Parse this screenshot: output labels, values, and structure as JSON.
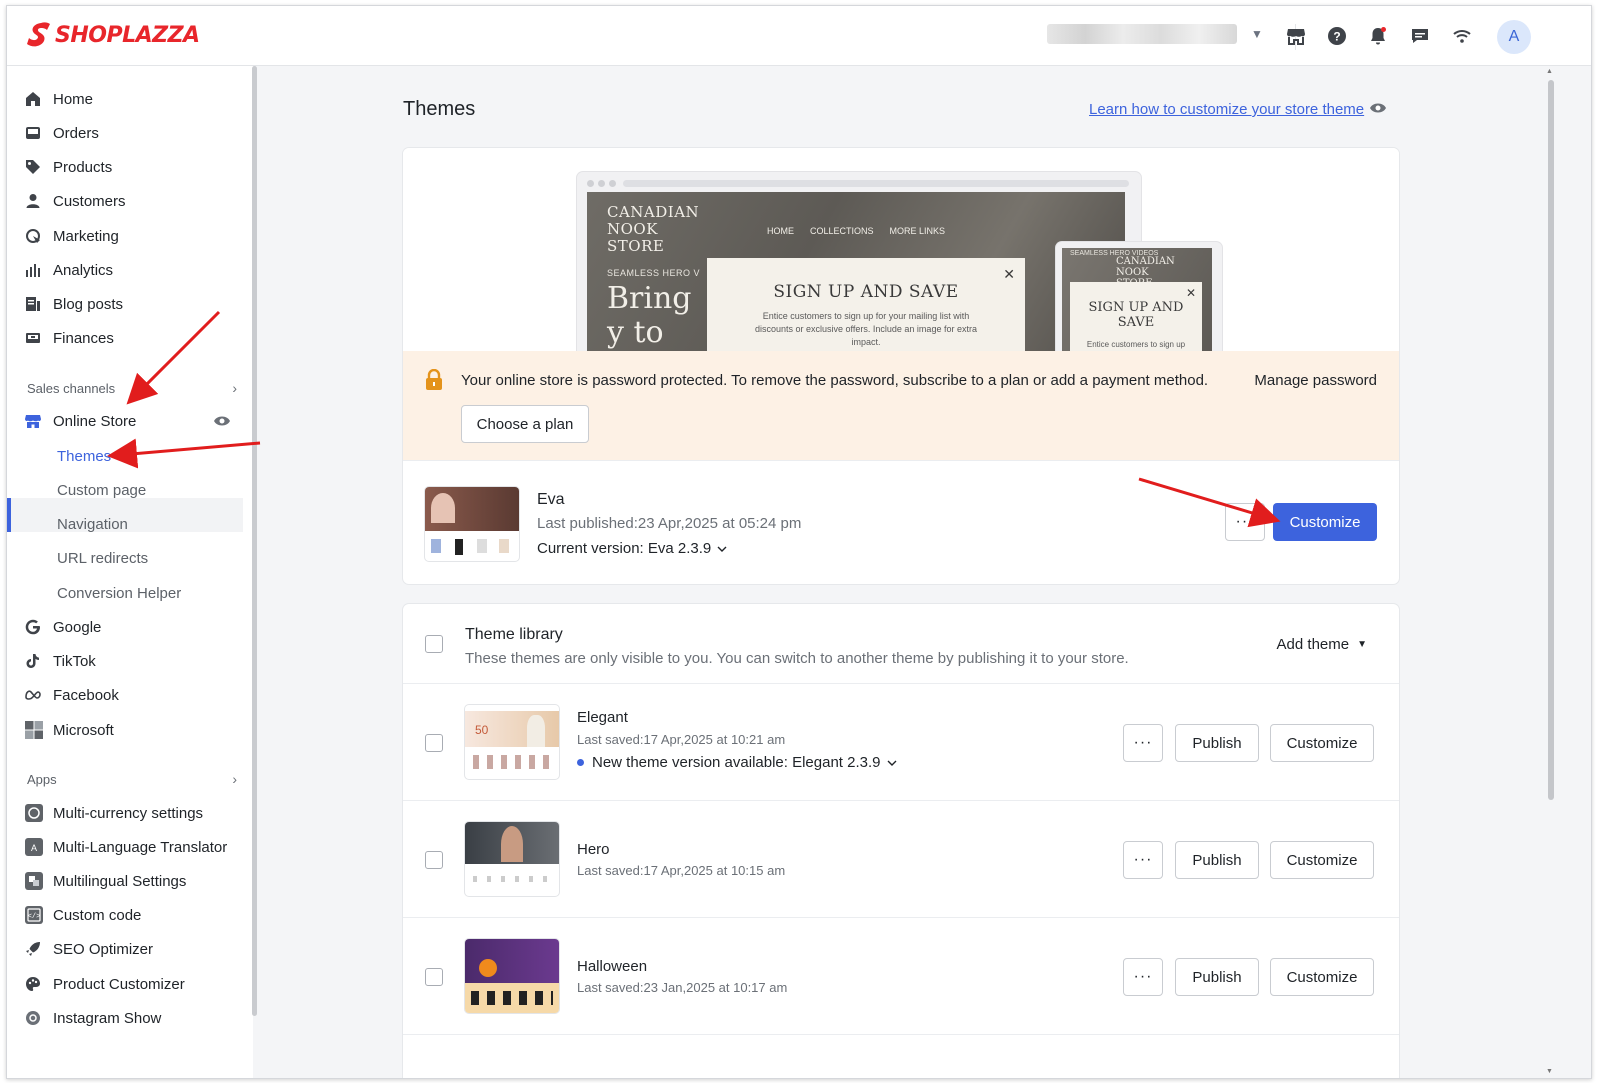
{
  "app": {
    "logo_text": "SHOPLAZZA",
    "avatar_letter": "A",
    "brand_color": "#e8262b",
    "accent_color": "#3d63dd",
    "top_icons": [
      "store-icon",
      "help-icon",
      "bell-icon",
      "chat-icon",
      "wifi-icon"
    ]
  },
  "sidebar": {
    "items": [
      {
        "label": "Home",
        "icon": "home-icon"
      },
      {
        "label": "Orders",
        "icon": "orders-icon"
      },
      {
        "label": "Products",
        "icon": "tag-icon"
      },
      {
        "label": "Customers",
        "icon": "person-icon"
      },
      {
        "label": "Marketing",
        "icon": "marketing-icon"
      },
      {
        "label": "Analytics",
        "icon": "analytics-icon"
      },
      {
        "label": "Blog posts",
        "icon": "blog-icon"
      },
      {
        "label": "Finances",
        "icon": "finances-icon"
      }
    ],
    "sales_channels_label": "Sales channels",
    "online_store_label": "Online Store",
    "online_store_sub": [
      "Themes",
      "Custom page",
      "Navigation",
      "URL redirects",
      "Conversion Helper"
    ],
    "channels": [
      {
        "label": "Google",
        "icon": "google-icon"
      },
      {
        "label": "TikTok",
        "icon": "tiktok-icon"
      },
      {
        "label": "Facebook",
        "icon": "meta-icon"
      },
      {
        "label": "Microsoft",
        "icon": "microsoft-icon"
      }
    ],
    "apps_label": "Apps",
    "apps": [
      {
        "label": "Multi-currency settings",
        "icon": "currency-icon"
      },
      {
        "label": "Multi-Language Translator",
        "icon": "translate-icon"
      },
      {
        "label": "Multilingual Settings",
        "icon": "language-icon"
      },
      {
        "label": "Custom code",
        "icon": "code-icon"
      },
      {
        "label": "SEO Optimizer",
        "icon": "rocket-icon"
      },
      {
        "label": "Product Customizer",
        "icon": "palette-icon"
      },
      {
        "label": "Instagram Show",
        "icon": "instagram-icon"
      }
    ]
  },
  "main": {
    "title": "Themes",
    "learn_link": "Learn how to customize your store theme",
    "preview": {
      "store_name": "CANADIAN NOOK STORE",
      "nav": [
        "HOME",
        "COLLECTIONS",
        "MORE LINKS"
      ],
      "tag": "SEAMLESS HERO V",
      "headline": "Bring y to life",
      "popup_title": "SIGN UP AND SAVE",
      "popup_text": "Entice customers to sign up for your mailing list with discounts or exclusive offers. Include an image for extra impact.",
      "tablet_tag": "SEAMLESS HERO VIDEOS",
      "tablet_store": "CANADIAN NOOK STORE",
      "tablet_popup_title": "SIGN UP AND SAVE",
      "tablet_popup_text": "Entice customers to sign up"
    },
    "banner": {
      "text": "Your online store is password protected. To remove the password, subscribe to a plan or add a payment method.",
      "manage_label": "Manage password",
      "choose_plan_label": "Choose a plan"
    },
    "current_theme": {
      "name": "Eva",
      "last_published": "Last published:23 Apr,2025 at 05:24 pm",
      "version": "Current version: Eva 2.3.9",
      "more_label": "···",
      "customize_label": "Customize"
    },
    "library": {
      "title": "Theme library",
      "subtitle": "These themes are only visible to you. You can switch to another theme by publishing it to your store.",
      "add_theme_label": "Add theme",
      "publish_label": "Publish",
      "customize_label": "Customize",
      "more_label": "···",
      "themes": [
        {
          "name": "Elegant",
          "saved": "Last saved:17 Apr,2025 at 10:21 am",
          "note": "New theme version available: Elegant 2.3.9"
        },
        {
          "name": "Hero",
          "saved": "Last saved:17 Apr,2025 at 10:15 am"
        },
        {
          "name": "Halloween",
          "saved": "Last saved:23 Jan,2025 at 10:17 am"
        }
      ]
    }
  }
}
